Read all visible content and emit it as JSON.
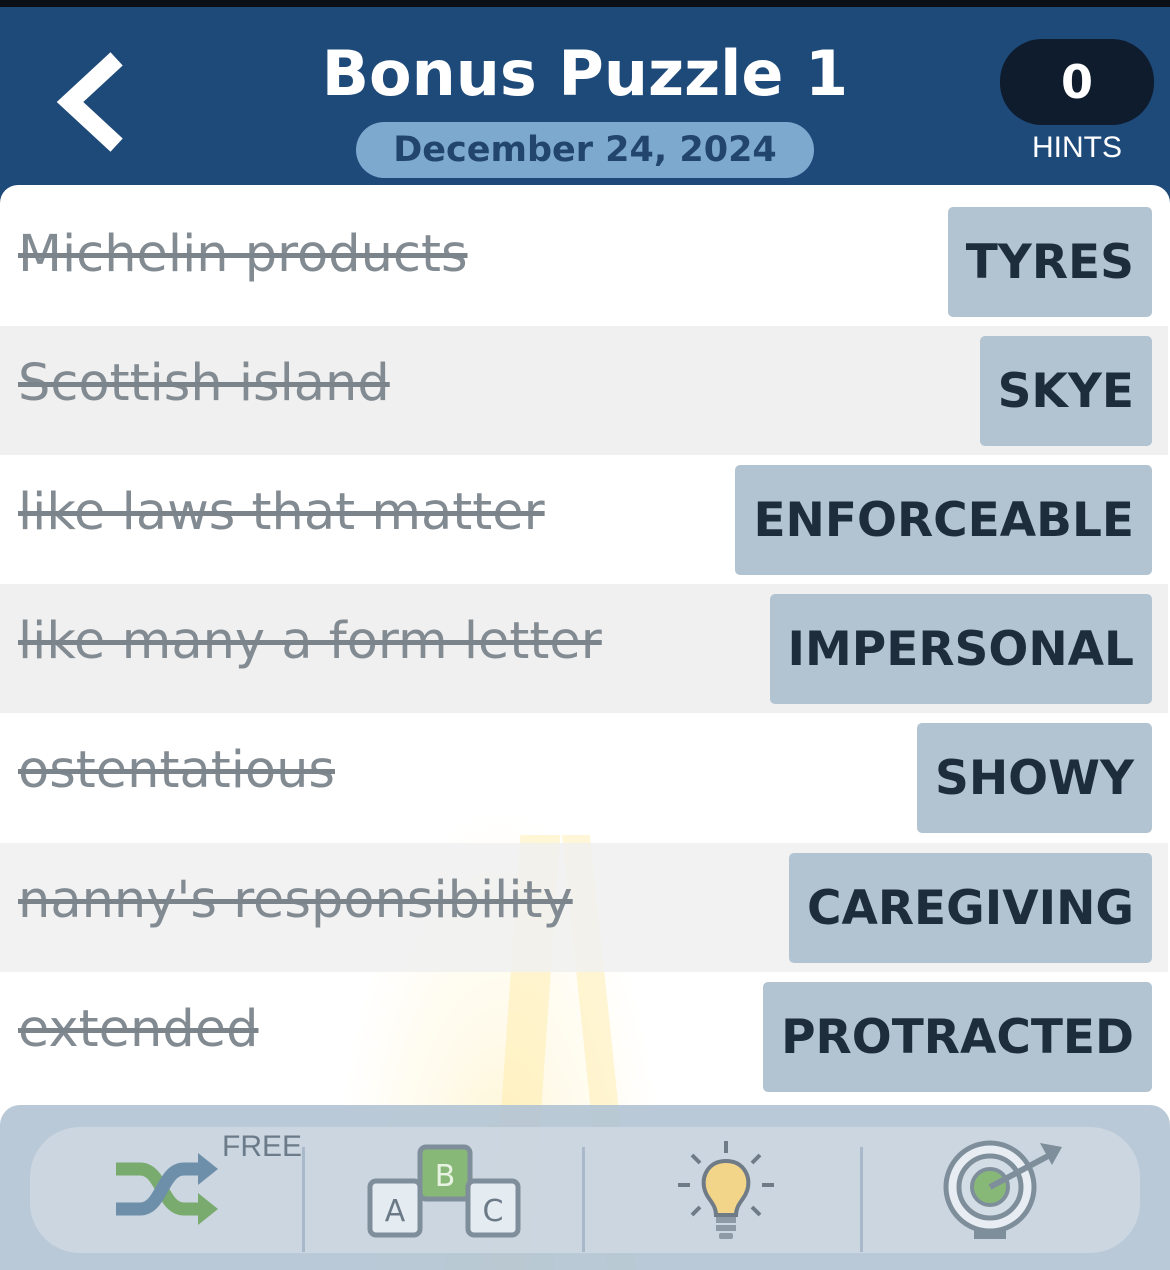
{
  "header": {
    "title": "Bonus Puzzle 1",
    "date": "December 24, 2024",
    "hints_count": "0",
    "hints_label": "HINTS"
  },
  "clues": [
    {
      "clue": "Michelin products",
      "answer": "TYRES"
    },
    {
      "clue": "Scottish island",
      "answer": "SKYE"
    },
    {
      "clue": "like laws that matter",
      "answer": "ENFORCEABLE"
    },
    {
      "clue": "like many a form letter",
      "answer": "IMPERSONAL"
    },
    {
      "clue": "ostentatious",
      "answer": "SHOWY"
    },
    {
      "clue": "nanny's responsibility",
      "answer": "CAREGIVING"
    },
    {
      "clue": "extended",
      "answer": "PROTRACTED"
    }
  ],
  "toolbar": {
    "shuffle_badge": "FREE",
    "icons": [
      "shuffle-icon",
      "abc-blocks-icon",
      "lightbulb-icon",
      "target-icon"
    ],
    "abc_letters": [
      "A",
      "B",
      "C"
    ]
  },
  "colors": {
    "header_bg": "#1e4a7a",
    "answer_bg": "#b2c3d1",
    "row_alt_bg": "#f0f0f0",
    "hints_bg": "#0f1c2e",
    "date_pill_bg": "#7ea9cf"
  }
}
